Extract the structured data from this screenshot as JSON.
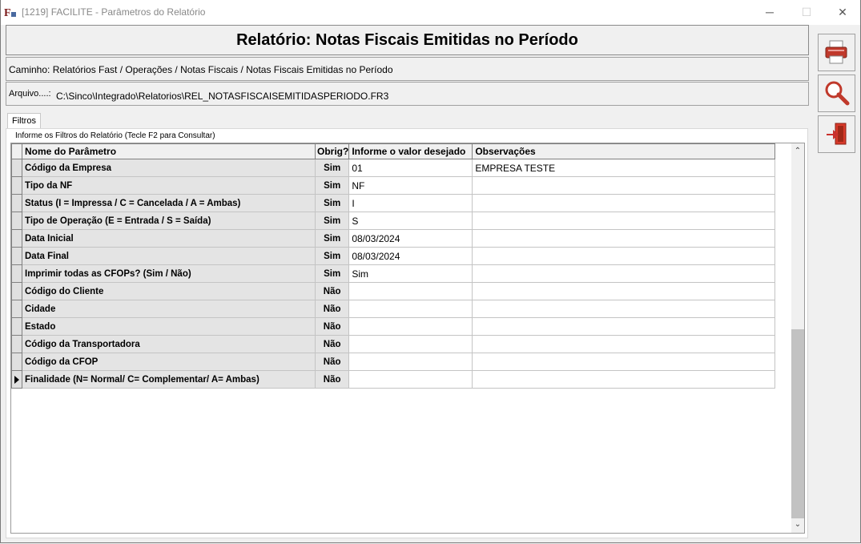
{
  "window": {
    "title": "[1219] FACILITE - Parâmetros do Relatório",
    "min": "─",
    "max": "☐",
    "close": "✕"
  },
  "report": {
    "title": "Relatório: Notas Fiscais Emitidas no Período",
    "path": "Caminho: Relatórios Fast / Operações / Notas Fiscais / Notas Fiscais Emitidas no Período",
    "file_label": "Arquivo....:",
    "file_value": "C:\\Sinco\\Integrado\\Relatorios\\REL_NOTASFISCAISEMITIDASPERIODO.FR3"
  },
  "tabs": {
    "filtros": "Filtros"
  },
  "group_label": "Informe os Filtros do Relatório (Tecle F2 para Consultar)",
  "columns": {
    "name": "Nome do Parâmetro",
    "obrig": "Obrig?",
    "value": "Informe o valor desejado",
    "obs": "Observações"
  },
  "rows": [
    {
      "name": "Código da Empresa",
      "obrig": "Sim",
      "value": "01",
      "obs": "EMPRESA TESTE"
    },
    {
      "name": "Tipo da NF",
      "obrig": "Sim",
      "value": "NF",
      "obs": ""
    },
    {
      "name": "Status (I = Impressa / C = Cancelada / A = Ambas)",
      "obrig": "Sim",
      "value": "I",
      "obs": ""
    },
    {
      "name": "Tipo de Operação (E = Entrada / S = Saída)",
      "obrig": "Sim",
      "value": "S",
      "obs": ""
    },
    {
      "name": "Data Inicial",
      "obrig": "Sim",
      "value": "08/03/2024",
      "obs": ""
    },
    {
      "name": "Data Final",
      "obrig": "Sim",
      "value": "08/03/2024",
      "obs": ""
    },
    {
      "name": "Imprimir todas as CFOPs? (Sim / Não)",
      "obrig": "Sim",
      "value": "Sim",
      "obs": ""
    },
    {
      "name": "Código do Cliente",
      "obrig": "Não",
      "value": "",
      "obs": ""
    },
    {
      "name": "Cidade",
      "obrig": "Não",
      "value": "",
      "obs": ""
    },
    {
      "name": "Estado",
      "obrig": "Não",
      "value": "",
      "obs": ""
    },
    {
      "name": "Código da Transportadora",
      "obrig": "Não",
      "value": "",
      "obs": ""
    },
    {
      "name": "Código da CFOP",
      "obrig": "Não",
      "value": "",
      "obs": ""
    },
    {
      "name": "Finalidade (N= Normal/ C= Complementar/ A= Ambas)",
      "obrig": "Não",
      "value": "",
      "obs": ""
    }
  ],
  "current_row": 12,
  "icons": {
    "print": "printer-icon",
    "preview": "magnifier-icon",
    "exit": "exit-door-icon"
  },
  "colors": {
    "exit_red": "#d83a2a",
    "printer_red": "#c0392b"
  }
}
